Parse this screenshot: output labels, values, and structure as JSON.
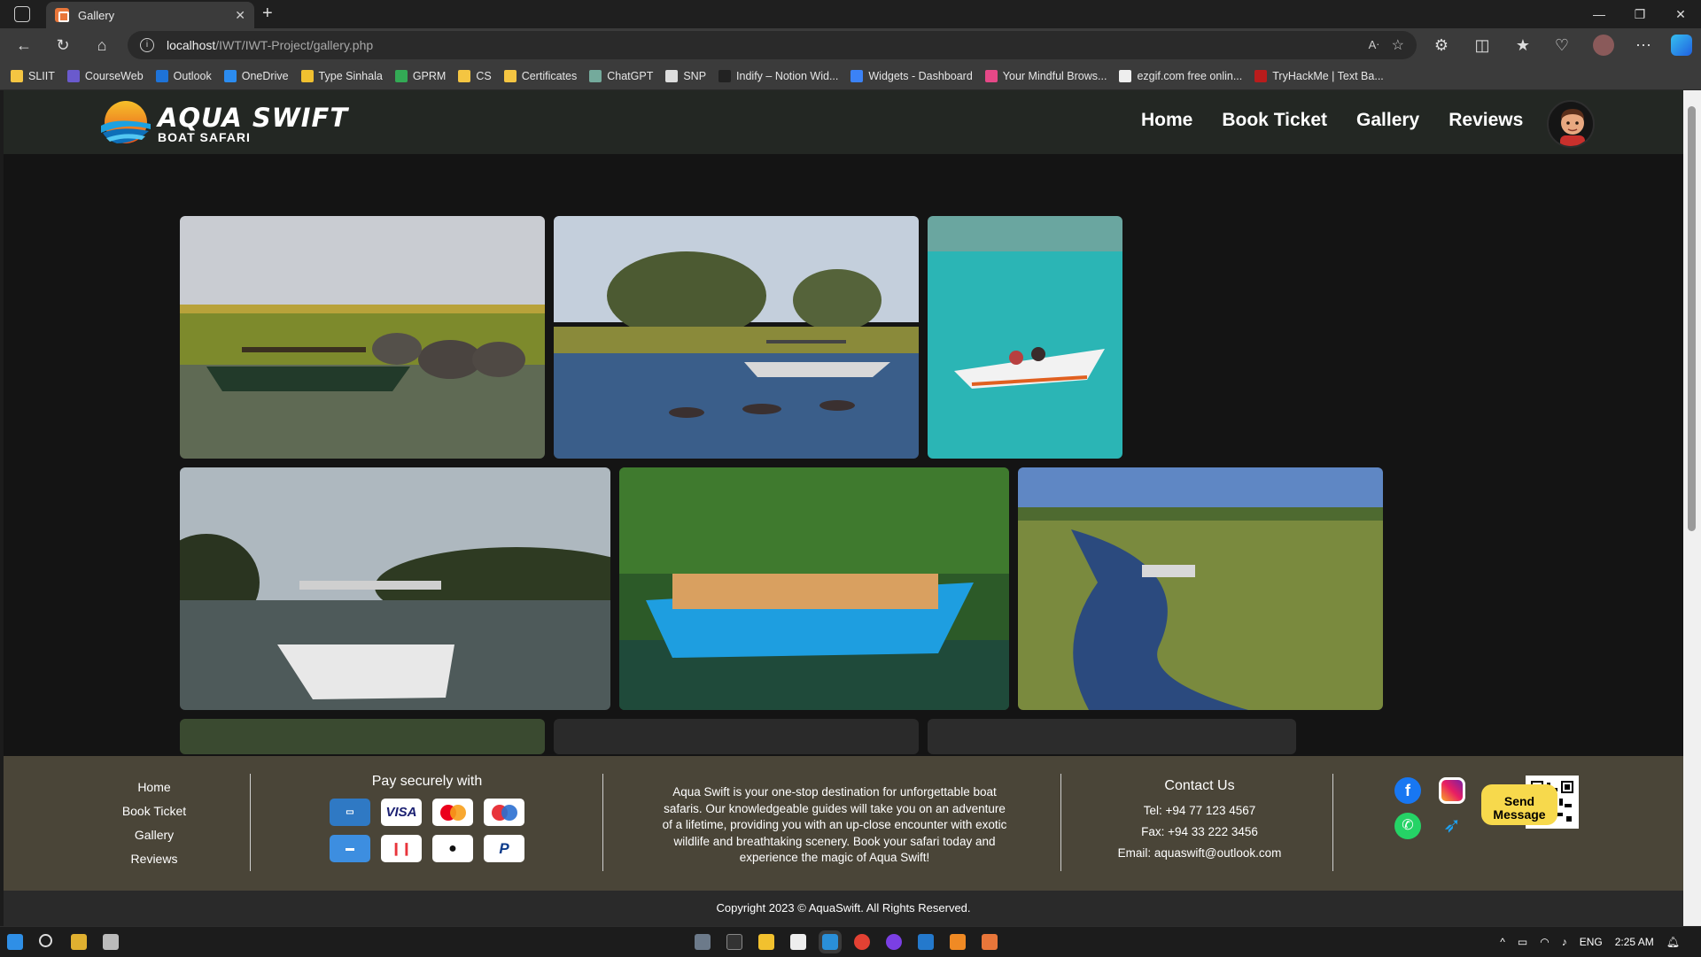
{
  "browser": {
    "tab_title": "Gallery",
    "url_host": "localhost",
    "url_path": "/IWT/IWT-Project/gallery.php",
    "bookmarks": [
      {
        "label": "SLIIT",
        "color": "#f4c542"
      },
      {
        "label": "CourseWeb",
        "color": "#6a5acd"
      },
      {
        "label": "Outlook",
        "color": "#1e73d8"
      },
      {
        "label": "OneDrive",
        "color": "#2b8cf0"
      },
      {
        "label": "Type Sinhala",
        "color": "#f0c030"
      },
      {
        "label": "GPRM",
        "color": "#33aa55"
      },
      {
        "label": "CS",
        "color": "#f4c542"
      },
      {
        "label": "Certificates",
        "color": "#f4c542"
      },
      {
        "label": "ChatGPT",
        "color": "#74aa9c"
      },
      {
        "label": "SNP",
        "color": "#dddddd"
      },
      {
        "label": "Indify – Notion Wid...",
        "color": "#222222"
      },
      {
        "label": "Widgets - Dashboard",
        "color": "#3b82f6"
      },
      {
        "label": "Your Mindful Brows...",
        "color": "#e54887"
      },
      {
        "label": "ezgif.com free onlin...",
        "color": "#eeeeee"
      },
      {
        "label": "TryHackMe | Text Ba...",
        "color": "#b91c1c"
      }
    ]
  },
  "site": {
    "logo_title": "AQUA SWIFT",
    "logo_subtitle": "BOAT SAFARI",
    "nav": [
      "Home",
      "Book Ticket",
      "Gallery",
      "Reviews"
    ]
  },
  "footer": {
    "links": [
      "Home",
      "Book Ticket",
      "Gallery",
      "Reviews"
    ],
    "pay_title": "Pay securely with",
    "payment_icons": [
      "amex-icon",
      "visa-icon",
      "mastercard-icon",
      "maestro-icon",
      "card-icon",
      "google-pay-icon",
      "apple-pay-icon",
      "paypal-icon"
    ],
    "visa_label": "VISA",
    "paypal_label": "P",
    "about": "Aqua Swift is your one-stop destination for unforgettable boat safaris. Our knowledgeable guides will take you on an adventure of a lifetime, providing you with an up-close encounter with exotic wildlife and breathtaking scenery. Book your safari today and experience the magic of Aqua Swift!",
    "contact_title": "Contact Us",
    "tel": "Tel: +94 77 123 4567",
    "fax": "Fax: +94 33 222 3456",
    "email": "Email: aquaswift@outlook.com",
    "send_label": "Send Message",
    "copyright": "Copyright 2023 © AquaSwift. All Rights Reserved."
  },
  "taskbar": {
    "lang": "ENG",
    "time": "2:25 AM"
  },
  "colors": {
    "navbar_bg": "#232723",
    "footer_bg": "#4a4538",
    "send_button": "#f7d94c"
  }
}
